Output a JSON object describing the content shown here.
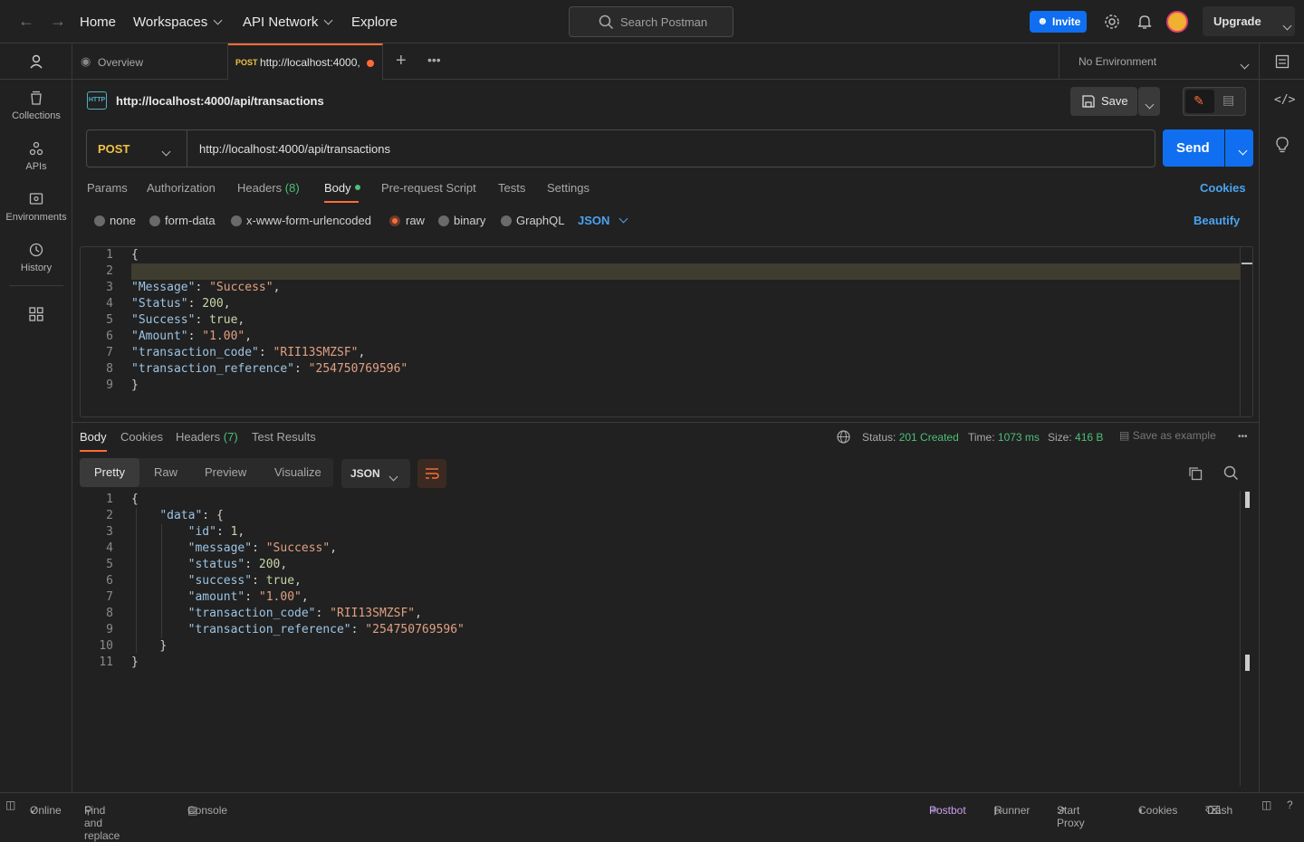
{
  "topbar": {
    "nav": [
      "Home",
      "Workspaces",
      "API Network",
      "Explore"
    ],
    "search_placeholder": "Search Postman",
    "invite_label": "Invite",
    "upgrade_label": "Upgrade"
  },
  "sidebar": {
    "items": [
      {
        "label": "Collections",
        "icon": "collections-icon"
      },
      {
        "label": "APIs",
        "icon": "apis-icon"
      },
      {
        "label": "Environments",
        "icon": "environments-icon"
      },
      {
        "label": "History",
        "icon": "history-icon"
      }
    ]
  },
  "tabs": {
    "overview_label": "Overview",
    "active_method": "POST",
    "active_label": "http://localhost:4000,",
    "environment": "No Environment"
  },
  "request": {
    "title": "http://localhost:4000/api/transactions",
    "save_label": "Save",
    "method": "POST",
    "url": "http://localhost:4000/api/transactions",
    "send_label": "Send",
    "subtabs": [
      "Params",
      "Authorization",
      "Headers",
      "Body",
      "Pre-request Script",
      "Tests",
      "Settings"
    ],
    "headers_count": "(8)",
    "cookies_label": "Cookies",
    "body_types": [
      "none",
      "form-data",
      "x-www-form-urlencoded",
      "raw",
      "binary",
      "GraphQL"
    ],
    "format": "JSON",
    "beautify_label": "Beautify",
    "body_lines": [
      "{",
      "",
      "\"Message\": \"Success\",",
      "\"Status\": 200,",
      "\"Success\": true,",
      "\"Amount\": \"1.00\",",
      "\"transaction_code\": \"RII13SMZSF\",",
      "\"transaction_reference\": \"254750769596\"",
      "}"
    ]
  },
  "response": {
    "tabs": [
      "Body",
      "Cookies",
      "Headers",
      "Test Results"
    ],
    "headers_count": "(7)",
    "status_label": "Status:",
    "status_value": "201 Created",
    "time_label": "Time:",
    "time_value": "1073 ms",
    "size_label": "Size:",
    "size_value": "416 B",
    "save_example": "Save as example",
    "view_tabs": [
      "Pretty",
      "Raw",
      "Preview",
      "Visualize"
    ],
    "format": "JSON",
    "body_lines": [
      "{",
      "    \"data\": {",
      "        \"id\": 1,",
      "        \"message\": \"Success\",",
      "        \"status\": 200,",
      "        \"success\": true,",
      "        \"amount\": \"1.00\",",
      "        \"transaction_code\": \"RII13SMZSF\",",
      "        \"transaction_reference\": \"254750769596\"",
      "    }",
      "}"
    ]
  },
  "statusbar": {
    "online": "Online",
    "find_replace": "Find and replace",
    "console": "Console",
    "postbot": "Postbot",
    "runner": "Runner",
    "start_proxy": "Start Proxy",
    "cookies": "Cookies",
    "trash": "Trash"
  },
  "colors": {
    "accent_orange": "#ff6c37",
    "send_blue": "#0f6ff0",
    "status_green": "#4dbf7a",
    "method_yellow": "#f0c246"
  }
}
